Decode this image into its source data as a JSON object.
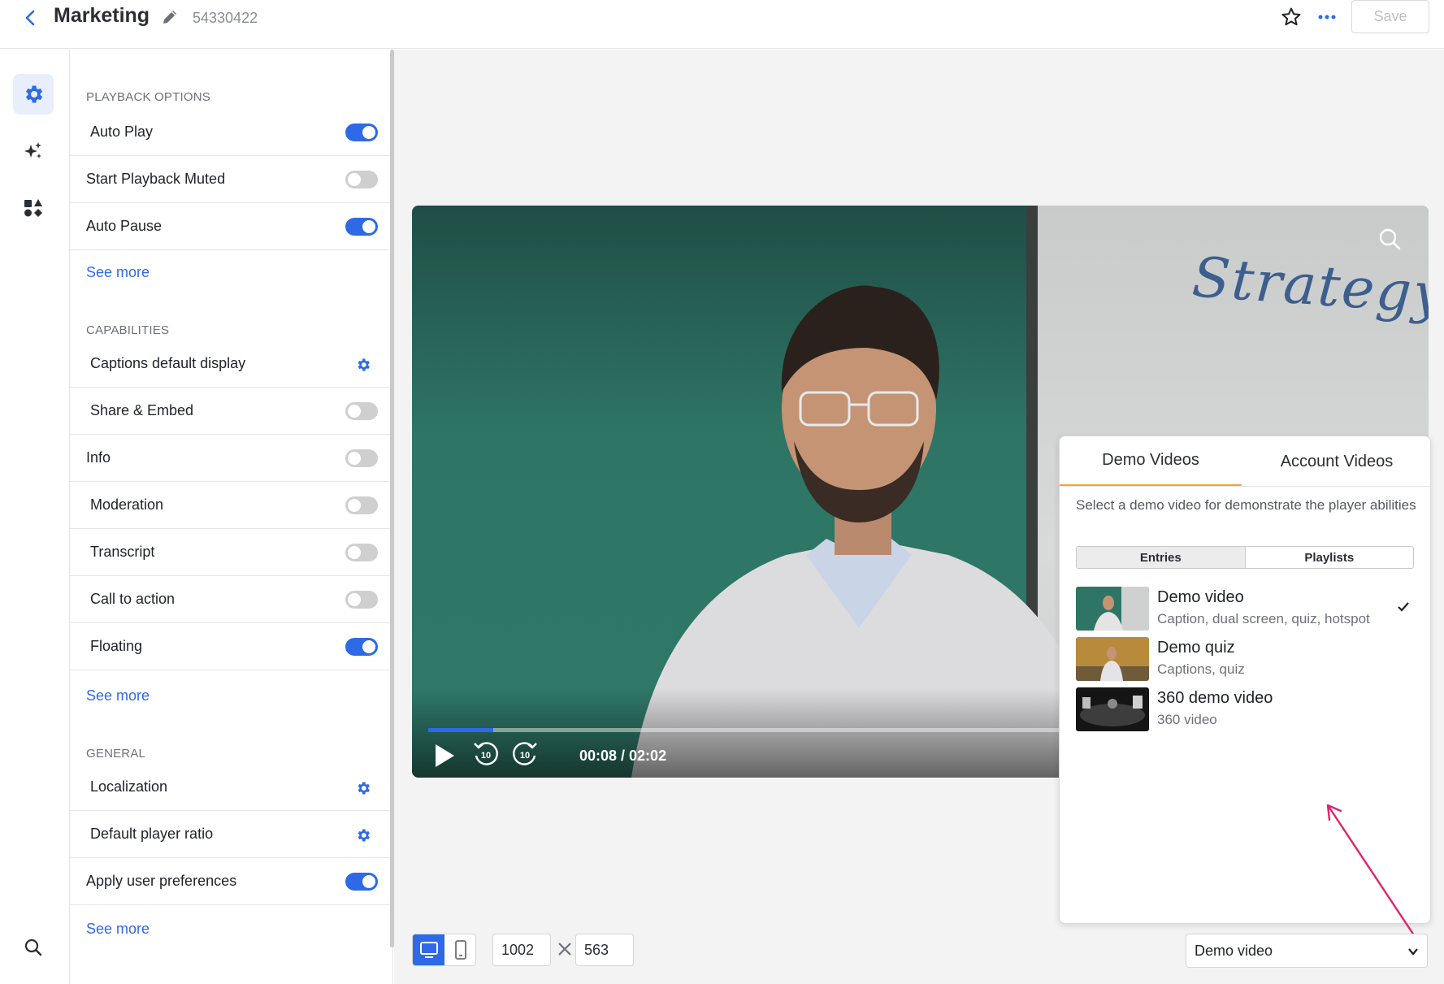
{
  "header": {
    "title": "Marketing",
    "entry_id": "54330422",
    "save_label": "Save"
  },
  "rail": {
    "items": [
      {
        "name": "settings",
        "icon": "gear-icon",
        "active": true
      },
      {
        "name": "plugins",
        "icon": "sparkles-icon",
        "active": false
      },
      {
        "name": "widgets",
        "icon": "shapes-icon",
        "active": false
      },
      {
        "name": "search",
        "icon": "search-icon",
        "active": false
      }
    ]
  },
  "panel": {
    "playback_title": "PLAYBACK OPTIONS",
    "playback": [
      {
        "label": "Auto Play",
        "control": "toggle",
        "on": true
      },
      {
        "label": "Start Playback Muted",
        "control": "toggle",
        "on": false
      },
      {
        "label": "Auto Pause",
        "control": "toggle",
        "on": true
      }
    ],
    "see_more_1": "See more",
    "capabilities_title": "CAPABILITIES",
    "capabilities": [
      {
        "label": "Captions default display",
        "control": "gear"
      },
      {
        "label": "Share & Embed",
        "control": "toggle",
        "on": false
      },
      {
        "label": "Info",
        "control": "toggle",
        "on": false
      },
      {
        "label": "Moderation",
        "control": "toggle",
        "on": false
      },
      {
        "label": "Transcript",
        "control": "toggle",
        "on": false
      },
      {
        "label": "Call to action",
        "control": "toggle",
        "on": false
      },
      {
        "label": "Floating",
        "control": "toggle",
        "on": true
      }
    ],
    "see_more_2": "See more",
    "general_title": "GENERAL",
    "general": [
      {
        "label": "Localization",
        "control": "gear"
      },
      {
        "label": "Default player ratio",
        "control": "gear"
      },
      {
        "label": "Apply user preferences",
        "control": "toggle",
        "on": true
      }
    ],
    "see_more_3": "See more"
  },
  "player": {
    "timecode": "00:08 / 02:02",
    "progress": 0.066,
    "board_text": "Strategy",
    "rewind_label": "10",
    "forward_label": "10"
  },
  "demo_popup": {
    "tabs": [
      {
        "label": "Demo Videos",
        "active": true
      },
      {
        "label": "Account Videos",
        "active": false
      }
    ],
    "description": "Select a demo video for demonstrate the player abilities",
    "segments": [
      {
        "label": "Entries",
        "selected": true
      },
      {
        "label": "Playlists",
        "selected": false
      }
    ],
    "videos": [
      {
        "name": "Demo video",
        "subtitle": "Caption, dual screen, quiz, hotspot",
        "selected": true
      },
      {
        "name": "Demo quiz",
        "subtitle": "Captions, quiz",
        "selected": false
      },
      {
        "name": "360 demo video",
        "subtitle": "360 video",
        "selected": false
      }
    ]
  },
  "toolbar": {
    "width_value": "1002",
    "height_value": "563",
    "demo_select_value": "Demo video"
  },
  "colors": {
    "accent": "#2e6ae6",
    "tab_underline": "#f2a33a",
    "annotation_arrow": "#e0246e"
  }
}
